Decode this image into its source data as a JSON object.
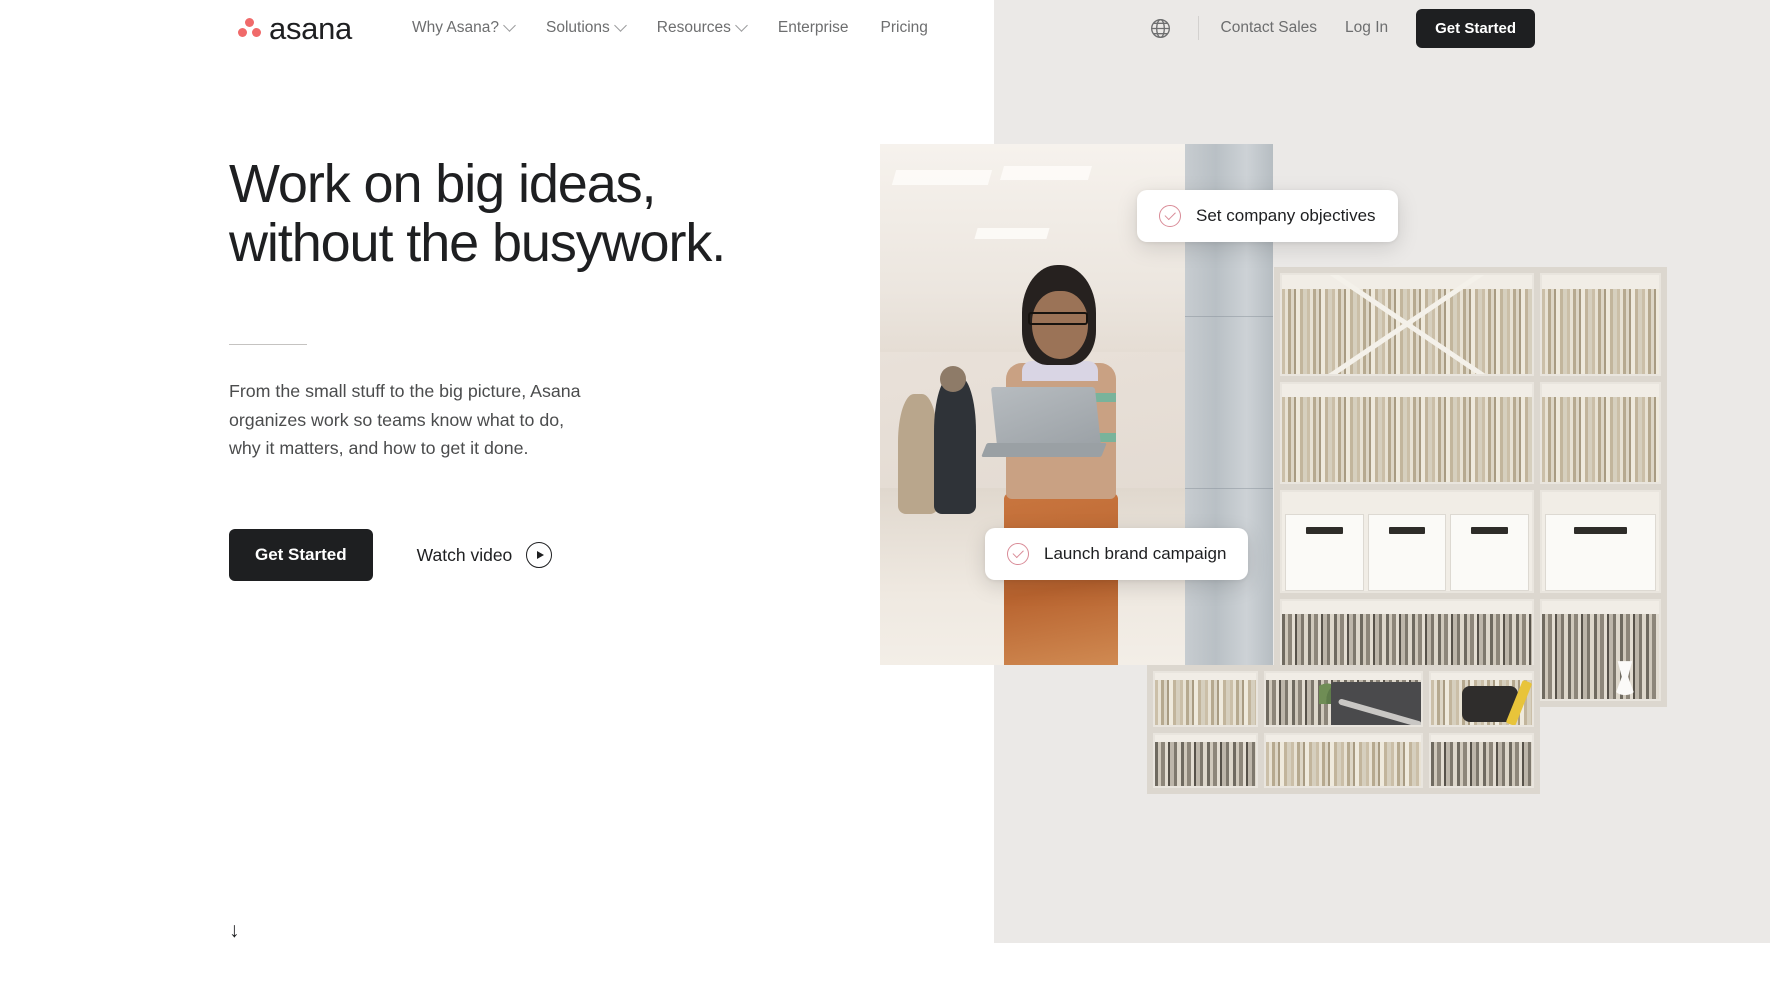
{
  "brand": {
    "name": "asana",
    "logo_icon": "asana-three-dots-logo",
    "accent_color": "#f06a6a",
    "ink_color": "#1e1f21",
    "panel_color": "#ebe9e7"
  },
  "nav": {
    "links": [
      {
        "label": "Why Asana?",
        "has_dropdown": true
      },
      {
        "label": "Solutions",
        "has_dropdown": true
      },
      {
        "label": "Resources",
        "has_dropdown": true
      },
      {
        "label": "Enterprise",
        "has_dropdown": false
      },
      {
        "label": "Pricing",
        "has_dropdown": false
      }
    ],
    "language_icon": "globe-icon",
    "contact_sales": "Contact Sales",
    "log_in": "Log In",
    "get_started": "Get Started"
  },
  "hero": {
    "headline": "Work on big ideas,\nwithout the busywork.",
    "subcopy": "From the small stuff to the big picture, Asana\norganizes work so teams know what to do,\nwhy it matters, and how to get it done.",
    "primary_cta": "Get Started",
    "secondary_cta": "Watch video",
    "secondary_cta_icon": "play-circle-icon",
    "scroll_hint_icon": "↓"
  },
  "task_cards": [
    {
      "label": "Set company objectives",
      "icon": "check-circle-icon",
      "icon_color": "#d98b97"
    },
    {
      "label": "Launch brand campaign",
      "icon": "check-circle-icon",
      "icon_color": "#d98b97"
    }
  ],
  "imagery": [
    {
      "name": "office-photo",
      "alt": "Woman with laptop leaning on a pillar in an open-plan office"
    },
    {
      "name": "shelves-photo",
      "alt": "Archive shelving filled with files, binders and storage boxes"
    },
    {
      "name": "desk-photo",
      "alt": "Desk with monitor on an arm among library shelving"
    }
  ]
}
